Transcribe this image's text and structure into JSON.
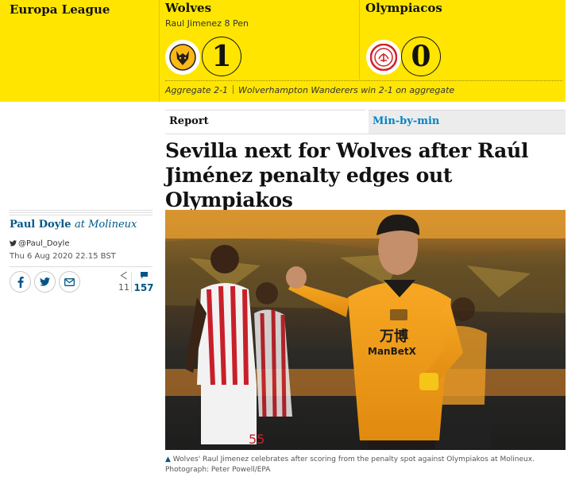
{
  "competition": "Europa League",
  "home": {
    "name": "Wolves",
    "scorer": "Raul Jimenez 8 Pen",
    "score": "1"
  },
  "away": {
    "name": "Olympiacos",
    "score": "0"
  },
  "aggregate": {
    "score": "Aggregate 2-1",
    "summary": "Wolverhampton Wanderers win 2-1 on aggregate"
  },
  "tabs": {
    "report": "Report",
    "minbymin": "Min-by-min"
  },
  "headline": "Sevilla next for Wolves after Raúl Jiménez penalty edges out Olympiakos",
  "byline": {
    "author": "Paul Doyle",
    "location": "at Molineux",
    "twitter": "@Paul_Doyle",
    "date": "Thu 6 Aug 2020 22.15 BST"
  },
  "share": {
    "count": "11",
    "comments": "157"
  },
  "photo": {
    "shirt_text": "万博",
    "shirt_sponsor": "ManBetX",
    "shirt_number": "55"
  },
  "caption": {
    "text": "Wolves' Raul Jimenez celebrates after scoring from the penalty spot against Olympiakos at Molineux.",
    "credit": "Photograph: Peter Powell/EPA"
  },
  "colors": {
    "band": "#ffe500",
    "link": "#005689",
    "tab_link": "#0084c6"
  },
  "icons": [
    "facebook-icon",
    "twitter-icon",
    "email-icon",
    "share-icon",
    "comment-icon",
    "wolves-crest-icon",
    "olympiacos-crest-icon",
    "caption-triangle-icon"
  ]
}
